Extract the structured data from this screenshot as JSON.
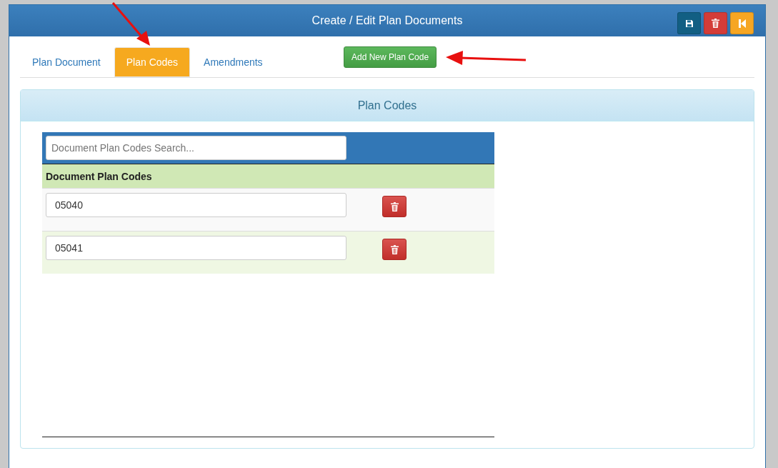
{
  "window": {
    "title": "Create / Edit Plan Documents"
  },
  "toolbar_buttons": [
    {
      "kind": "save"
    },
    {
      "kind": "delete"
    },
    {
      "kind": "back"
    }
  ],
  "tabs": [
    {
      "label": "Plan Document",
      "selected": false
    },
    {
      "label": "Plan Codes",
      "selected": true
    },
    {
      "label": "Amendments",
      "selected": false
    }
  ],
  "add_button": {
    "label": "Add New Plan Code"
  },
  "panel": {
    "title": "Plan Codes",
    "search": {
      "placeholder": "Document Plan Codes Search..."
    },
    "column": "Document Plan Codes",
    "rows": [
      {
        "value": "05040"
      },
      {
        "value": "05041"
      }
    ]
  }
}
